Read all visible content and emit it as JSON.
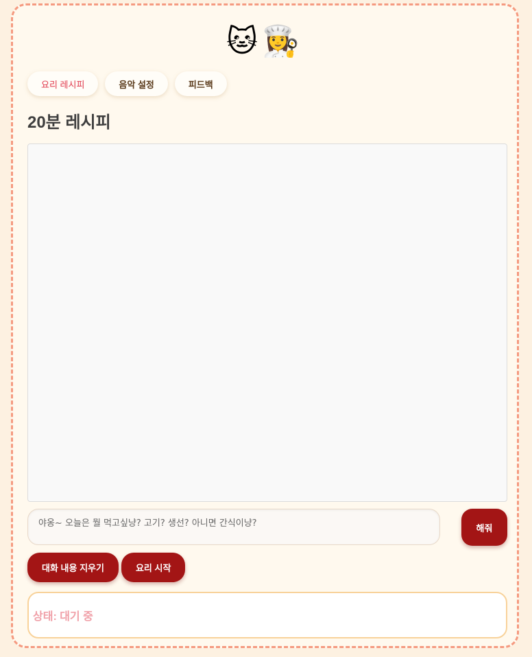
{
  "header": {
    "mascots": "🐱👩‍🍳"
  },
  "tabs": [
    {
      "label": "요리 레시피",
      "active": true
    },
    {
      "label": "음악 설정",
      "active": false
    },
    {
      "label": "피드백",
      "active": false
    }
  ],
  "main": {
    "title": "20분 레시피"
  },
  "chat": {
    "placeholder": "야옹~ 오늘은 뭘 먹고싶냥? 고기? 생선? 아니면 간식이냥?",
    "send_label": "해줘"
  },
  "actions": {
    "clear_label": "대화 내용 지우기",
    "start_label": "요리 시작"
  },
  "status": {
    "text": "상태: 대기 중"
  },
  "colors": {
    "accent": "#a31515",
    "border": "#f59a80",
    "background": "#fff9ee"
  }
}
